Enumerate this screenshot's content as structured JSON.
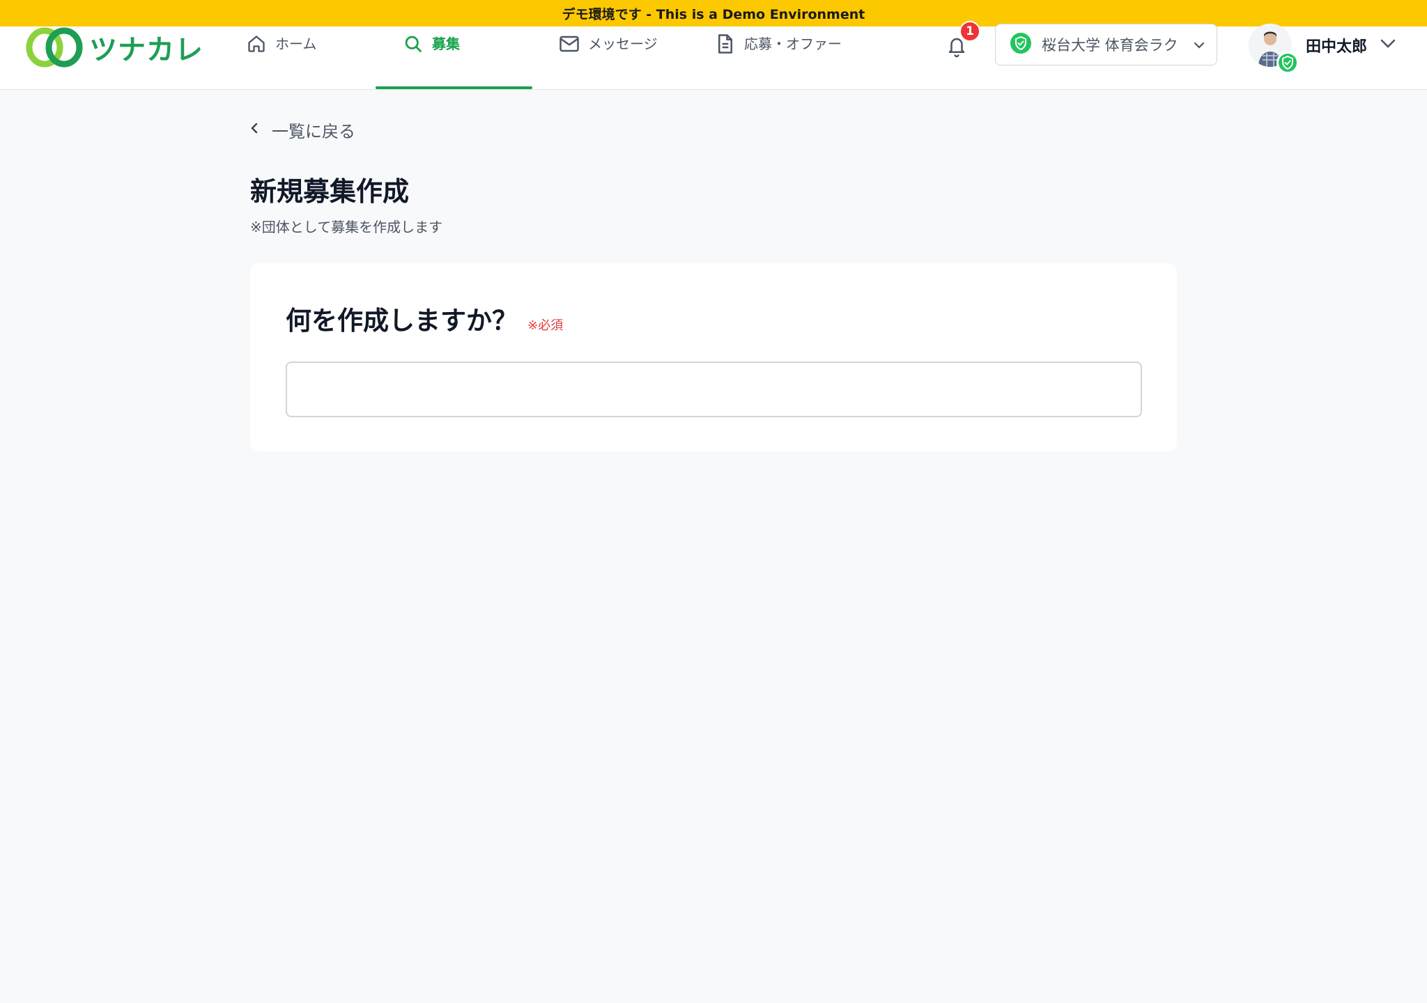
{
  "banner": {
    "text": "デモ環境です - This is a Demo Environment"
  },
  "brand": {
    "name": "ツナカレ"
  },
  "nav": {
    "items": [
      {
        "label": "ホーム",
        "icon": "home-icon"
      },
      {
        "label": "募集",
        "icon": "search-icon",
        "active": true
      },
      {
        "label": "メッセージ",
        "icon": "mail-icon"
      },
      {
        "label": "応募・オファー",
        "icon": "document-icon"
      }
    ],
    "notifications": {
      "count": "1"
    },
    "org": {
      "label": "桜台大学 体育会ラク"
    },
    "user": {
      "name": "田中太郎"
    }
  },
  "page": {
    "back_label": "一覧に戻る",
    "title": "新規募集作成",
    "subtitle": "※団体として募集を作成します"
  },
  "form": {
    "question": "何を作成しますか？",
    "required_label": "※必須",
    "input_value": ""
  },
  "colors": {
    "banner": "#fcc800",
    "accent": "#16a34a",
    "badge": "#ef3434",
    "required": "#e23b3b"
  }
}
